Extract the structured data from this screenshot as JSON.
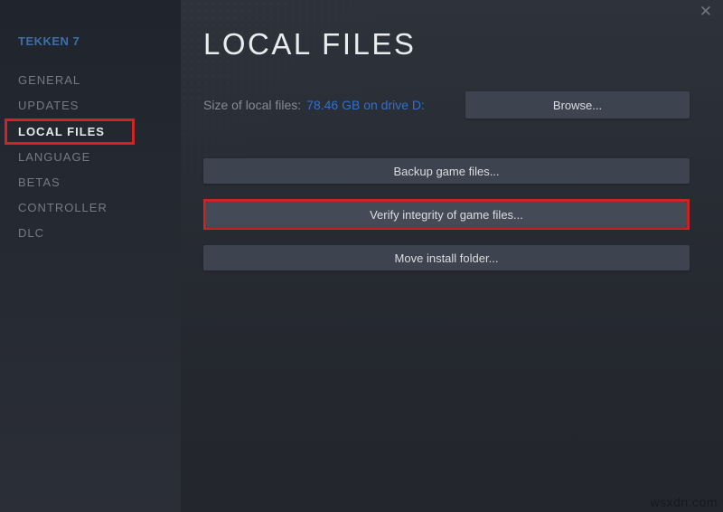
{
  "window": {
    "close_icon": "✕"
  },
  "sidebar": {
    "game_title": "TEKKEN 7",
    "items": [
      {
        "label": "GENERAL",
        "active": false
      },
      {
        "label": "UPDATES",
        "active": false
      },
      {
        "label": "LOCAL FILES",
        "active": true,
        "highlighted": true
      },
      {
        "label": "LANGUAGE",
        "active": false
      },
      {
        "label": "BETAS",
        "active": false
      },
      {
        "label": "CONTROLLER",
        "active": false
      },
      {
        "label": "DLC",
        "active": false
      }
    ]
  },
  "main": {
    "title": "LOCAL FILES",
    "size_label": "Size of local files:",
    "size_value": "78.46 GB on drive D:",
    "browse_button": "Browse...",
    "action_buttons": [
      {
        "label": "Backup game files...",
        "highlighted": false
      },
      {
        "label": "Verify integrity of game files...",
        "highlighted": true
      },
      {
        "label": "Move install folder...",
        "highlighted": false
      }
    ]
  },
  "watermark": "wsxdn.com",
  "colors": {
    "sidebar_top": "#20242c",
    "main_top": "#2e323b",
    "main_bottom": "#24262e",
    "button_bg": "#3d444f",
    "highlight_red": "#d02424",
    "link_blue": "#2e70d4",
    "game_title_blue": "#3e6ea9",
    "inactive_text": "#747b83",
    "active_text": "#e6e9ec"
  }
}
